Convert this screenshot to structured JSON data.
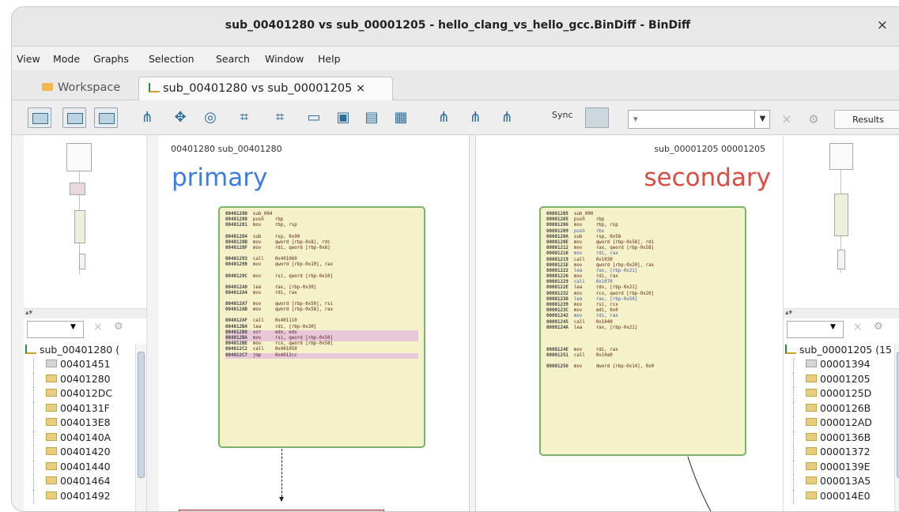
{
  "window": {
    "title": "sub_00401280 vs sub_00001205 - hello_clang_vs_hello_gcc.BinDiff - BinDiff",
    "close_label": "×"
  },
  "menu": [
    "View",
    "Mode",
    "Graphs",
    "Selection",
    "Search",
    "Window",
    "Help"
  ],
  "tabs": [
    {
      "label": "Workspace",
      "icon": "folder-icon"
    },
    {
      "label": "sub_00401280 vs sub_00001205 ×",
      "icon": "graph-icon",
      "active": true
    }
  ],
  "toolbar": {
    "sync_label": "Sync",
    "combo_value": "▾",
    "results_label": "Results"
  },
  "left_tree": {
    "root": "sub_00401280 (",
    "items": [
      "00401451",
      "00401280",
      "004012DC",
      "0040131F",
      "004013E8",
      "0040140A",
      "00401420",
      "00401440",
      "00401464",
      "00401492"
    ]
  },
  "right_tree": {
    "root": "sub_00001205 (15",
    "items": [
      "00001394",
      "00001205",
      "0000125D",
      "0000126B",
      "000012AD",
      "0000136B",
      "00001372",
      "0000139E",
      "000013A5",
      "000014E0"
    ]
  },
  "graph_left": {
    "header": "00401280 sub_00401280",
    "label": "primary",
    "block_rows": [
      [
        "00401280",
        "sub_00401280",
        "",
        false
      ],
      [
        "00401280",
        "push",
        "rbp",
        false
      ],
      [
        "00401281",
        "mov",
        "rbp, rsp",
        false
      ],
      [
        "gap"
      ],
      [
        "00401284",
        "sub",
        "rsp, 0x90",
        false
      ],
      [
        "0040128B",
        "mov",
        "qword [rbp-0x8], rdi",
        false
      ],
      [
        "0040128F",
        "mov",
        "rdi, qword [rbp-0x8]",
        false
      ],
      [
        "gap"
      ],
      [
        "00401293",
        "call",
        "0x401060",
        false
      ],
      [
        "00401298",
        "mov",
        "qword [rbp-0x10], rax",
        false
      ],
      [
        "gap"
      ],
      [
        "0040129C",
        "mov",
        "rsi, qword [rbp-0x10]",
        false
      ],
      [
        "gap"
      ],
      [
        "004012A0",
        "lea",
        "rax, [rbp-0x30]",
        false
      ],
      [
        "004012A4",
        "mov",
        "rdi, rax",
        false
      ],
      [
        "gap"
      ],
      [
        "004012A7",
        "mov",
        "qword [rbp-0x50], rsi",
        false
      ],
      [
        "004012AB",
        "mov",
        "qword [rbp-0x58], rax",
        false
      ],
      [
        "gap"
      ],
      [
        "004012AF",
        "call",
        "0x401110",
        false
      ],
      [
        "004012B4",
        "lea",
        "rdi, [rbp-0x30]",
        false
      ],
      [
        "004012B8",
        "xor",
        "edx, edx",
        true
      ],
      [
        "004012BA",
        "mov",
        "rsi, qword [rbp-0x50]",
        true
      ],
      [
        "004012BE",
        "mov",
        "rcx, qword [rbp-0x58]",
        false
      ],
      [
        "004012C2",
        "call",
        "0x401050",
        false
      ],
      [
        "004012C7",
        "jmp",
        "0x4012cc",
        true
      ]
    ]
  },
  "graph_right": {
    "header": "sub_00001205 00001205",
    "label": "secondary",
    "block_rows": [
      [
        "00001205",
        "sub_00001205",
        "",
        false
      ],
      [
        "00001205",
        "push",
        "rbp",
        false
      ],
      [
        "00001206",
        "mov",
        "rbp, rsp",
        false
      ],
      [
        "00001209",
        "push",
        "rbx",
        "blue"
      ],
      [
        "0000120A",
        "sub",
        "rsp, 0x58",
        false
      ],
      [
        "0000120E",
        "mov",
        "qword [rbp-0x58], rdi",
        false
      ],
      [
        "00001212",
        "mov",
        "rax, qword [rbp-0x58]",
        false
      ],
      [
        "00001216",
        "mov",
        "rdi, rax",
        "blue"
      ],
      [
        "00001219",
        "call",
        "0x1030",
        false
      ],
      [
        "0000121E",
        "mov",
        "qword [rbp-0x20], rax",
        false
      ],
      [
        "00001222",
        "lea",
        "rax, [rbp-0x21]",
        "blue"
      ],
      [
        "00001226",
        "mov",
        "rdi, rax",
        false
      ],
      [
        "00001229",
        "call",
        "0x1070",
        "blue"
      ],
      [
        "0000122E",
        "lea",
        "rdx, [rbp-0x21]",
        false
      ],
      [
        "00001232",
        "mov",
        "rcx, qword [rbp-0x20]",
        false
      ],
      [
        "00001236",
        "lea",
        "rax, [rbp-0x50]",
        "blue"
      ],
      [
        "00001239",
        "mov",
        "rsi, rcx",
        false
      ],
      [
        "0000123C",
        "mov",
        "edi, 0x0",
        false
      ],
      [
        "00001242",
        "mov",
        "rdi, rax",
        "blue"
      ],
      [
        "00001245",
        "call",
        "0x1040",
        false
      ],
      [
        "0000124A",
        "lea",
        "rax, [rbp-0x21]",
        false
      ],
      [
        "gap"
      ],
      [
        "gap"
      ],
      [
        "gap"
      ],
      [
        "0000124E",
        "mov",
        "rdi, rax",
        false
      ],
      [
        "00001251",
        "call",
        "0x10a0",
        false
      ],
      [
        "gap"
      ],
      [
        "00001256",
        "mov",
        "dword [rbp-0x14], 0x0",
        false
      ]
    ]
  },
  "icons": [
    "folder-icon",
    "graph-icon",
    "close-icon",
    "gear-icon",
    "sync-icon"
  ]
}
